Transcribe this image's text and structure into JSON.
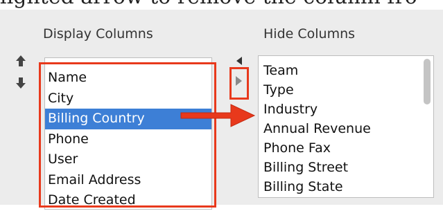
{
  "caption": "lighted arrow to remove the column fro",
  "headers": {
    "display": "Display Columns",
    "hide": "Hide Columns"
  },
  "display_columns": [
    "Name",
    "City",
    "Billing Country",
    "Phone",
    "User",
    "Email Address",
    "Date Created"
  ],
  "selected_display_index": 2,
  "hide_columns": [
    "Team",
    "Type",
    "Industry",
    "Annual Revenue",
    "Phone Fax",
    "Billing Street",
    "Billing State"
  ],
  "icons": {
    "move_up": "arrow-up-icon",
    "move_down": "arrow-down-icon",
    "move_left": "triangle-left-icon",
    "move_right": "triangle-right-icon"
  },
  "colors": {
    "highlight": "#e8391c",
    "selection": "#3d7fd6",
    "panel": "#ececec"
  }
}
